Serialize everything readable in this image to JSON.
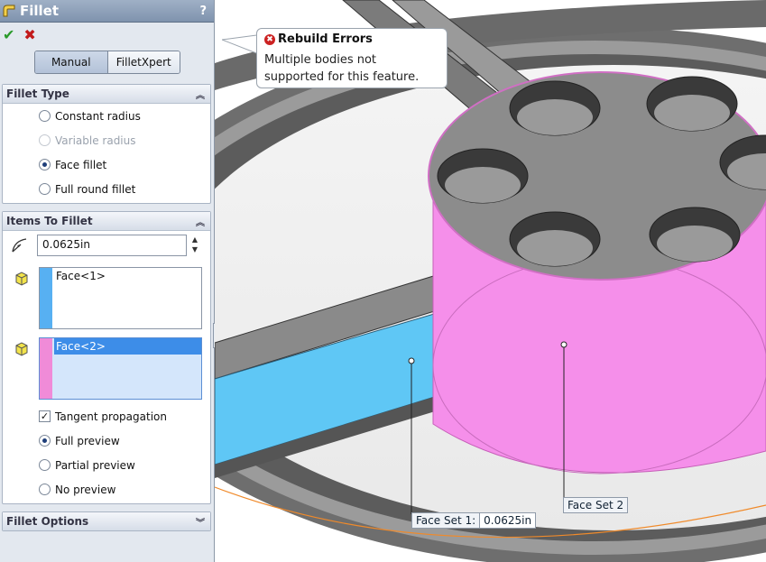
{
  "panel": {
    "title": "Fillet",
    "help": "?",
    "ok_symbol": "✔",
    "cancel_symbol": "✖",
    "tabs": [
      "Manual",
      "FilletXpert"
    ],
    "fillet_type": {
      "header": "Fillet Type",
      "options": [
        "Constant radius",
        "Variable radius",
        "Face fillet",
        "Full round fillet"
      ]
    },
    "items_to_fillet": {
      "header": "Items To Fillet",
      "radius": "0.0625in",
      "face_set1": "Face<1>",
      "face_set2": "Face<2>",
      "tangent": "Tangent propagation",
      "preview_options": [
        "Full preview",
        "Partial preview",
        "No preview"
      ]
    },
    "fillet_options": {
      "header": "Fillet Options"
    }
  },
  "viewport": {
    "tooltip": {
      "title": "Rebuild Errors",
      "line1": "Multiple bodies not",
      "line2": "supported for this feature."
    },
    "face_set1_label": "Face Set 1:",
    "face_set1_value": "0.0625in",
    "face_set2_label": "Face Set 2"
  },
  "colors": {
    "face1": "#5fc7f5",
    "face2": "#f58fea",
    "cylinder_top": "#8c8c8c",
    "panel_bg": "#e3e8ef"
  }
}
